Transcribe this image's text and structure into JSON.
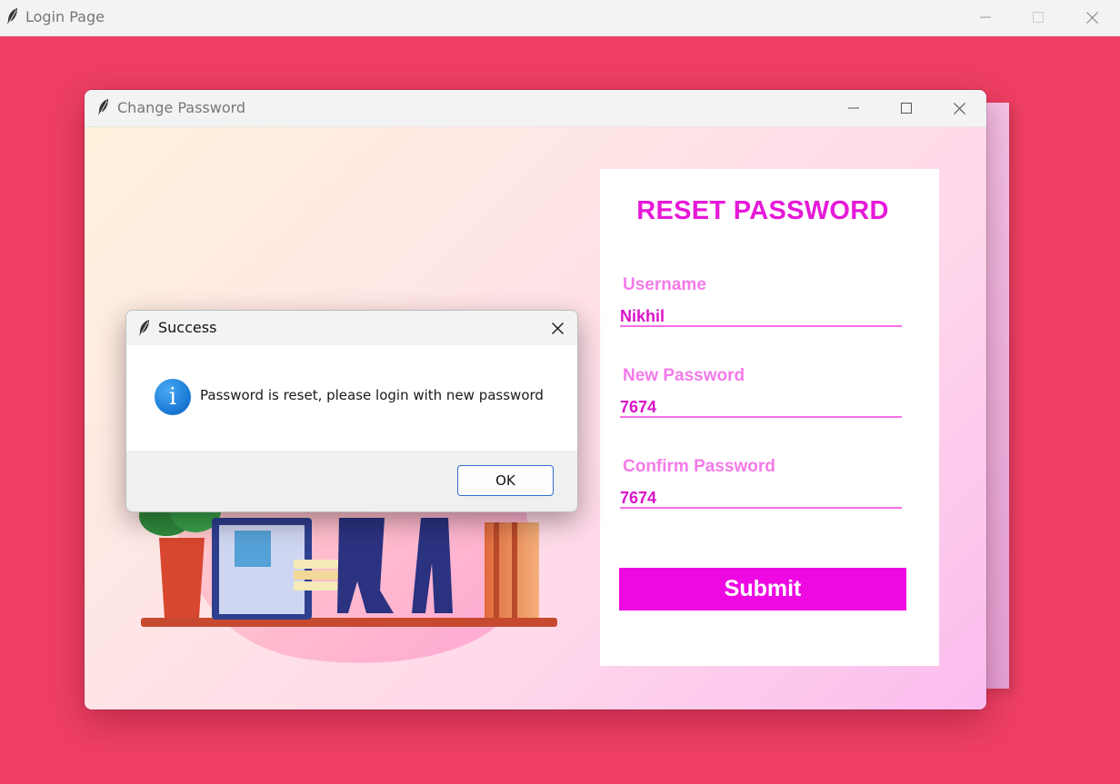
{
  "main_window": {
    "title": "Login Page",
    "app_icon": "feather-icon",
    "controls": [
      "minimize-icon",
      "maximize-icon",
      "close-icon"
    ]
  },
  "child_window": {
    "title": "Change Password",
    "app_icon": "feather-icon",
    "controls": [
      "minimize-icon",
      "maximize-icon",
      "close-icon"
    ]
  },
  "form": {
    "title": "RESET PASSWORD",
    "username_label": "Username",
    "username_value": "Nikhil",
    "new_password_label": "New Password",
    "new_password_value": "7674",
    "confirm_password_label": "Confirm Password",
    "confirm_password_value": "7674",
    "submit_label": "Submit"
  },
  "dialog": {
    "title": "Success",
    "icon": "info-icon",
    "message": "Password is reset, please login with new password",
    "ok_label": "OK"
  },
  "colors": {
    "main_background": "#ef3f63",
    "accent_title": "#e619d8",
    "label": "#f47ae9",
    "submit_button": "#ee08e2",
    "ok_border": "#2f6fd0"
  }
}
